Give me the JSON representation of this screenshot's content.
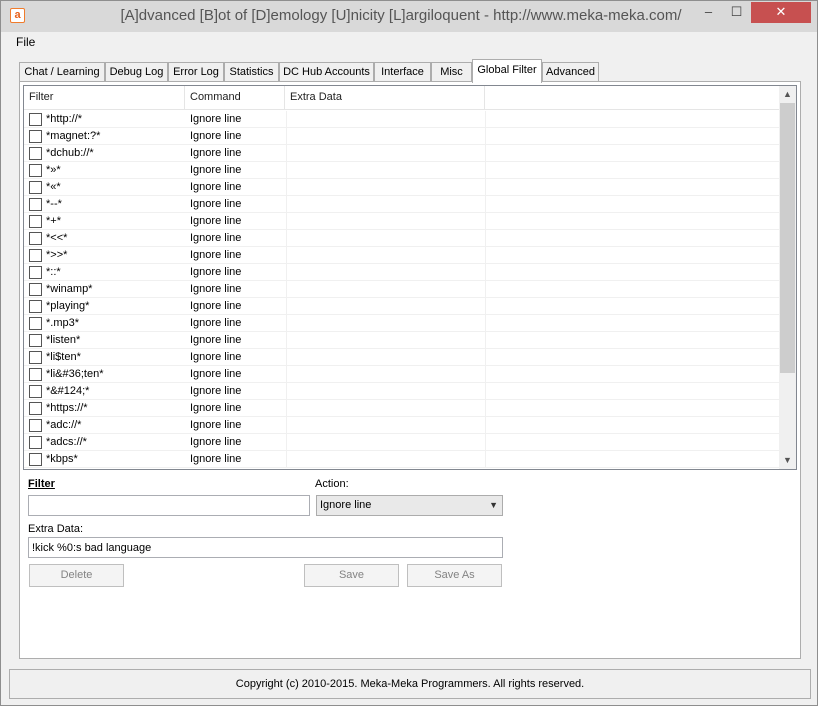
{
  "window": {
    "title": "[A]dvanced [B]ot of [D]emology [U]nicity [L]argiloquent - http://www.meka-meka.com/",
    "icon_letter": "a",
    "minimize_glyph": "–",
    "maximize_glyph": "☐",
    "close_glyph": "✕"
  },
  "menu": {
    "file": "File"
  },
  "tabs": [
    {
      "label": "Chat / Learning"
    },
    {
      "label": "Debug Log"
    },
    {
      "label": "Error Log"
    },
    {
      "label": "Statistics"
    },
    {
      "label": "DC Hub Accounts"
    },
    {
      "label": "Interface"
    },
    {
      "label": "Misc"
    },
    {
      "label": "Global Filter"
    },
    {
      "label": "Advanced"
    }
  ],
  "active_tab": "Global Filter",
  "grid": {
    "columns": [
      "Filter",
      "Command",
      "Extra Data"
    ],
    "rows": [
      {
        "filter": "*http://*",
        "command": "Ignore line",
        "extra": ""
      },
      {
        "filter": "*magnet:?*",
        "command": "Ignore line",
        "extra": ""
      },
      {
        "filter": "*dchub://*",
        "command": "Ignore line",
        "extra": ""
      },
      {
        "filter": "*»*",
        "command": "Ignore line",
        "extra": ""
      },
      {
        "filter": "*«*",
        "command": "Ignore line",
        "extra": ""
      },
      {
        "filter": "*--*",
        "command": "Ignore line",
        "extra": ""
      },
      {
        "filter": "*+*",
        "command": "Ignore line",
        "extra": ""
      },
      {
        "filter": "*<<*",
        "command": "Ignore line",
        "extra": ""
      },
      {
        "filter": "*>>*",
        "command": "Ignore line",
        "extra": ""
      },
      {
        "filter": "*::*",
        "command": "Ignore line",
        "extra": ""
      },
      {
        "filter": "*winamp*",
        "command": "Ignore line",
        "extra": ""
      },
      {
        "filter": "*playing*",
        "command": "Ignore line",
        "extra": ""
      },
      {
        "filter": "*.mp3*",
        "command": "Ignore line",
        "extra": ""
      },
      {
        "filter": "*listen*",
        "command": "Ignore line",
        "extra": ""
      },
      {
        "filter": "*li$ten*",
        "command": "Ignore line",
        "extra": ""
      },
      {
        "filter": "*li&#36;ten*",
        "command": "Ignore line",
        "extra": ""
      },
      {
        "filter": "*&#124;*",
        "command": "Ignore line",
        "extra": ""
      },
      {
        "filter": "*https://*",
        "command": "Ignore line",
        "extra": ""
      },
      {
        "filter": "*adc://*",
        "command": "Ignore line",
        "extra": ""
      },
      {
        "filter": "*adcs://*",
        "command": "Ignore line",
        "extra": ""
      },
      {
        "filter": "*kbps*",
        "command": "Ignore line",
        "extra": ""
      }
    ],
    "scroll_up_glyph": "▲",
    "scroll_down_glyph": "▼"
  },
  "form": {
    "filter_label": "Filter",
    "filter_value": "",
    "action_label": "Action:",
    "action_value": "Ignore line",
    "action_chevron": "▼",
    "extra_label": "Extra Data:",
    "extra_value": "!kick %0:s bad language",
    "delete_label": "Delete",
    "save_label": "Save",
    "save_as_label": "Save As"
  },
  "status": {
    "copyright": "Copyright (c) 2010-2015. Meka-Meka Programmers. All rights reserved."
  }
}
